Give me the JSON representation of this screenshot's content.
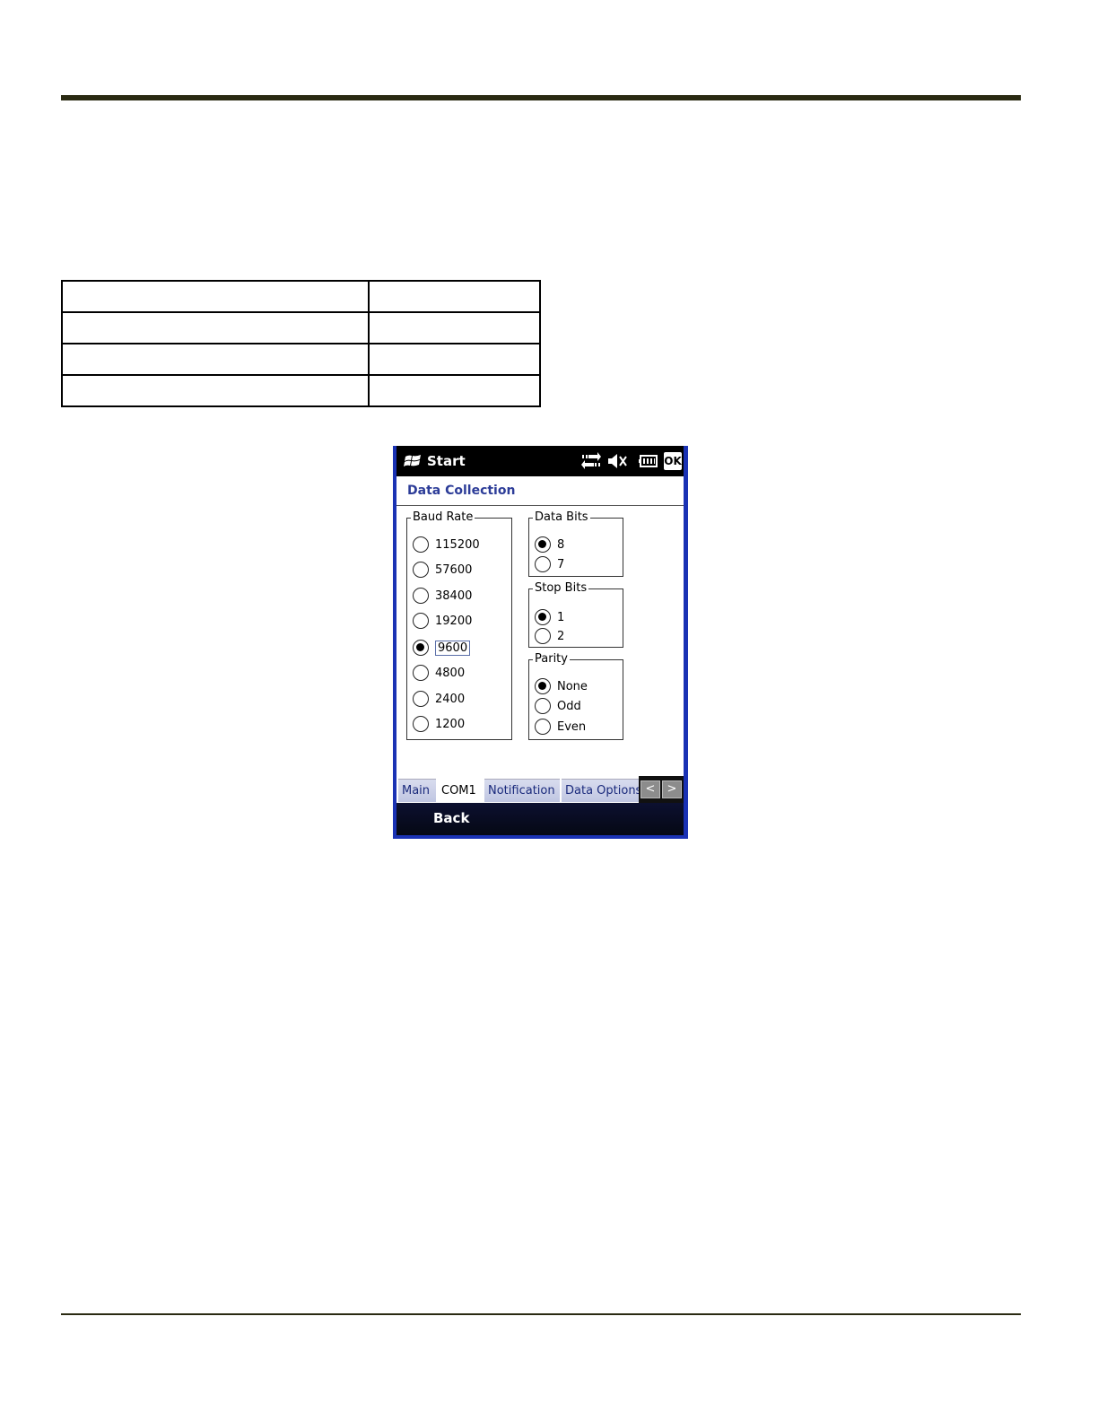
{
  "device": {
    "titlebar": {
      "start_label": "Start",
      "icons": [
        "windows-logo-icon",
        "connectivity-arrows-icon",
        "speaker-muted-icon",
        "battery-icon"
      ],
      "ok_label": "OK"
    },
    "app_title": "Data Collection",
    "baud_rate": {
      "legend": "Baud Rate",
      "options": [
        "115200",
        "57600",
        "38400",
        "19200",
        "9600",
        "4800",
        "2400",
        "1200"
      ],
      "selected": "9600"
    },
    "data_bits": {
      "legend": "Data Bits",
      "options": [
        "8",
        "7"
      ],
      "selected": "8"
    },
    "stop_bits": {
      "legend": "Stop Bits",
      "options": [
        "1",
        "2"
      ],
      "selected": "1"
    },
    "parity": {
      "legend": "Parity",
      "options": [
        "None",
        "Odd",
        "Even"
      ],
      "selected": "None"
    },
    "tabs": [
      "Main",
      "COM1",
      "Notification",
      "Data Options"
    ],
    "active_tab": "COM1",
    "tab_scroll": [
      "<",
      ">"
    ],
    "softkey_left": "Back"
  }
}
